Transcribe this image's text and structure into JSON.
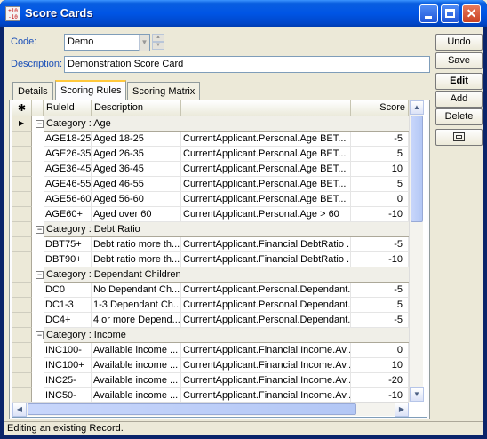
{
  "window": {
    "title": "Score Cards",
    "icon_text": "f+10\n-10",
    "controls": [
      "minimize-icon",
      "maximize-icon",
      "close-icon"
    ]
  },
  "form": {
    "code_label": "Code:",
    "code_value": "Demo",
    "description_label": "Description:",
    "description_value": "Demonstration Score Card"
  },
  "buttons": {
    "undo": "Undo",
    "save": "Save",
    "edit": "Edit",
    "add": "Add",
    "delete": "Delete",
    "extra_icon": "edit-rules-icon"
  },
  "tabs": [
    {
      "label": "Details",
      "active": false
    },
    {
      "label": "Scoring Rules",
      "active": true
    },
    {
      "label": "Scoring Matrix",
      "active": false
    }
  ],
  "grid": {
    "corner": "✱",
    "headers": {
      "rule_id": "RuleId",
      "description": "Description",
      "expression": "",
      "score": "Score"
    },
    "groups": [
      {
        "category": "Category : Age",
        "rows": [
          {
            "rule_id": "AGE18-25",
            "description": "Aged 18-25",
            "expression": "CurrentApplicant.Personal.Age BET...",
            "score": "-5"
          },
          {
            "rule_id": "AGE26-35",
            "description": "Aged 26-35",
            "expression": "CurrentApplicant.Personal.Age BET...",
            "score": "5"
          },
          {
            "rule_id": "AGE36-45",
            "description": "Aged 36-45",
            "expression": "CurrentApplicant.Personal.Age BET...",
            "score": "10"
          },
          {
            "rule_id": "AGE46-55",
            "description": "Aged 46-55",
            "expression": "CurrentApplicant.Personal.Age BET...",
            "score": "5"
          },
          {
            "rule_id": "AGE56-60",
            "description": "Aged 56-60",
            "expression": "CurrentApplicant.Personal.Age BET...",
            "score": "0"
          },
          {
            "rule_id": "AGE60+",
            "description": "Aged over 60",
            "expression": "CurrentApplicant.Personal.Age > 60",
            "score": "-10"
          }
        ]
      },
      {
        "category": "Category : Debt Ratio",
        "rows": [
          {
            "rule_id": "DBT75+",
            "description": "Debt ratio more th...",
            "expression": "CurrentApplicant.Financial.DebtRatio ...",
            "score": "-5"
          },
          {
            "rule_id": "DBT90+",
            "description": "Debt ratio more th...",
            "expression": "CurrentApplicant.Financial.DebtRatio ...",
            "score": "-10"
          }
        ]
      },
      {
        "category": "Category : Dependant Children",
        "rows": [
          {
            "rule_id": "DC0",
            "description": "No Dependant Ch...",
            "expression": "CurrentApplicant.Personal.Dependant...",
            "score": "-5"
          },
          {
            "rule_id": "DC1-3",
            "description": "1-3 Dependant Ch...",
            "expression": "CurrentApplicant.Personal.Dependant...",
            "score": "5"
          },
          {
            "rule_id": "DC4+",
            "description": "4 or more Depend...",
            "expression": "CurrentApplicant.Personal.Dependant...",
            "score": "-5"
          }
        ]
      },
      {
        "category": "Category : Income",
        "rows": [
          {
            "rule_id": "INC100-",
            "description": "Available income ...",
            "expression": "CurrentApplicant.Financial.Income.Av...",
            "score": "0"
          },
          {
            "rule_id": "INC100+",
            "description": "Available income ...",
            "expression": "CurrentApplicant.Financial.Income.Av...",
            "score": "10"
          },
          {
            "rule_id": "INC25-",
            "description": "Available income ...",
            "expression": "CurrentApplicant.Financial.Income.Av...",
            "score": "-20"
          },
          {
            "rule_id": "INC50-",
            "description": "Available income ...",
            "expression": "CurrentApplicant.Financial.Income.Av...",
            "score": "-10"
          }
        ]
      }
    ]
  },
  "status": {
    "text": "Editing an existing Record."
  },
  "colors": {
    "title_bar": "#0055e5",
    "label_blue": "#1a4fb8",
    "tab_highlight": "#ffc83c",
    "window_bg": "#ece9d8"
  }
}
